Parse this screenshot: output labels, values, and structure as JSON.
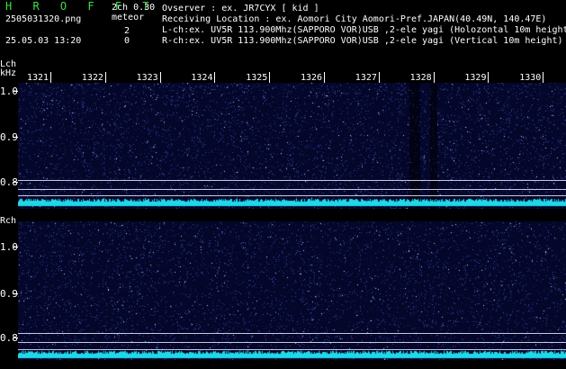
{
  "header": {
    "app_title": "H R O F F T",
    "channel_mode": "2ch 0.30",
    "filename": "2505031320.png",
    "meteor_label": "meteor",
    "meteor_counts": [
      "2",
      "0"
    ],
    "datetime": "25.05.03 13:20",
    "observer_line": "Ovserver            : ex. JR7CYX [ kid ]",
    "location_line": "Receiving Location : ex. Aomori City Aomori-Pref.JAPAN(40.49N, 140.47E)",
    "lch_line": "L-ch:ex. UV5R 113.900Mhz(SAPPORO VOR)USB ,2-ele yagi (Holozontal 10m height)",
    "rch_line": "R-ch:ex. UV5R 113.900Mhz(SAPPORO VOR)USB ,2-ele yagi (Vertical 10m height)"
  },
  "time_axis": {
    "labels": [
      "1321",
      "1322",
      "1323",
      "1324",
      "1325",
      "1326",
      "1327",
      "1328",
      "1329",
      "1330"
    ]
  },
  "lch": {
    "label": "Lch",
    "unit": "kHz",
    "y_labels": [
      "1.0",
      "0.9",
      "0.8"
    ]
  },
  "rch": {
    "label": "Rch",
    "y_labels": [
      "1.0",
      "0.9",
      "0.8"
    ]
  },
  "colors": {
    "header_green": "#3fe04a",
    "background": "#000000",
    "waterfall": "#04062a",
    "baseline": "#1fd8e8"
  }
}
